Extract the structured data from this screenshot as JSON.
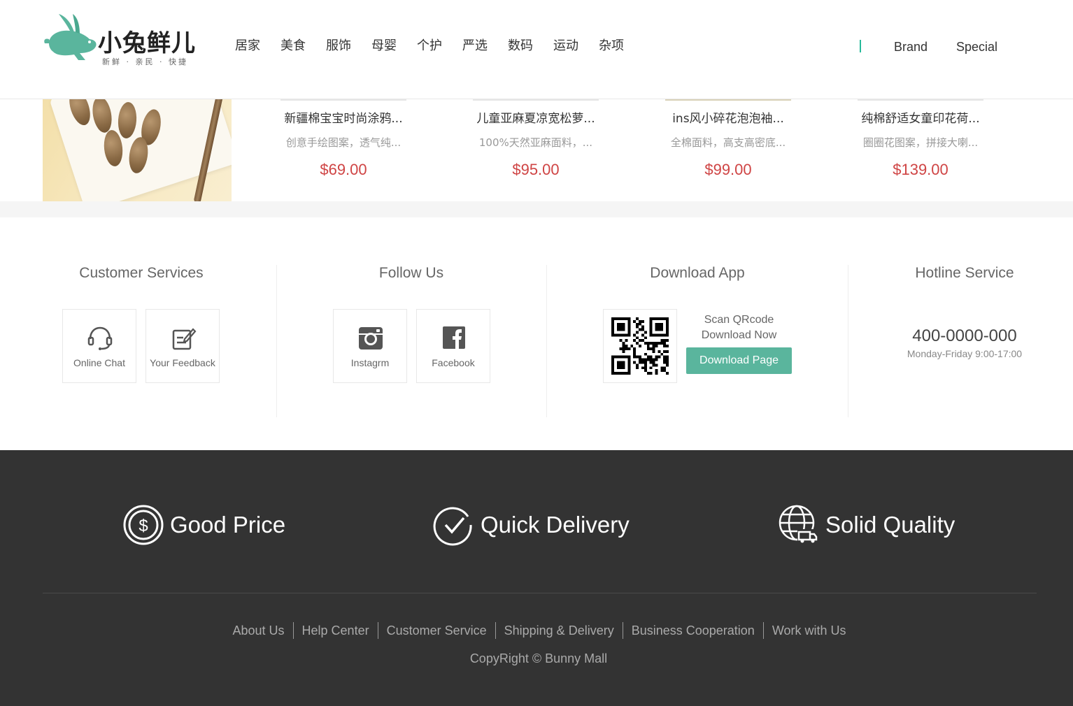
{
  "header": {
    "logo_text": "小兔鲜儿",
    "logo_tagline": "新鲜 · 亲民 · 快捷",
    "nav_items": [
      "居家",
      "美食",
      "服饰",
      "母婴",
      "个护",
      "严选",
      "数码",
      "运动",
      "杂项"
    ],
    "brand_label": "Brand",
    "special_label": "Special",
    "accent_color": "#27ba9b"
  },
  "products": [
    {
      "name": "新疆棉宝宝时尚涂鸦...",
      "desc": "创意手绘图案，透气纯...",
      "price": "$69.00"
    },
    {
      "name": "儿童亚麻夏凉宽松萝...",
      "desc": "100%天然亚麻面料，...",
      "price": "$95.00"
    },
    {
      "name": "ins风小碎花泡泡袖...",
      "desc": "全棉面料，高支高密底...",
      "price": "$99.00"
    },
    {
      "name": "纯棉舒适女童印花荷...",
      "desc": "圈圈花图案，拼接大喇...",
      "price": "$139.00"
    }
  ],
  "services": {
    "customer": {
      "title": "Customer Services",
      "online_chat": "Online Chat",
      "feedback": "Your Feedback"
    },
    "follow": {
      "title": "Follow Us",
      "instagram": "Instagrm",
      "facebook": "Facebook"
    },
    "app": {
      "title": "Download App",
      "scan": "Scan QRcode",
      "download_now": "Download Now",
      "button": "Download Page"
    },
    "hotline": {
      "title": "Hotline Service",
      "number": "400-0000-000",
      "hours": "Monday-Friday 9:00-17:00"
    }
  },
  "footer": {
    "features": [
      "Good Price",
      "Quick Delivery",
      "Solid Quality"
    ],
    "links": [
      "About Us",
      "Help Center",
      "Customer Service",
      "Shipping & Delivery",
      "Business Cooperation",
      "Work with Us"
    ],
    "copyright": "CopyRight © Bunny Mall"
  },
  "colors": {
    "price": "#cf4444",
    "button": "#5ab59d",
    "footer_bg": "#333333"
  }
}
